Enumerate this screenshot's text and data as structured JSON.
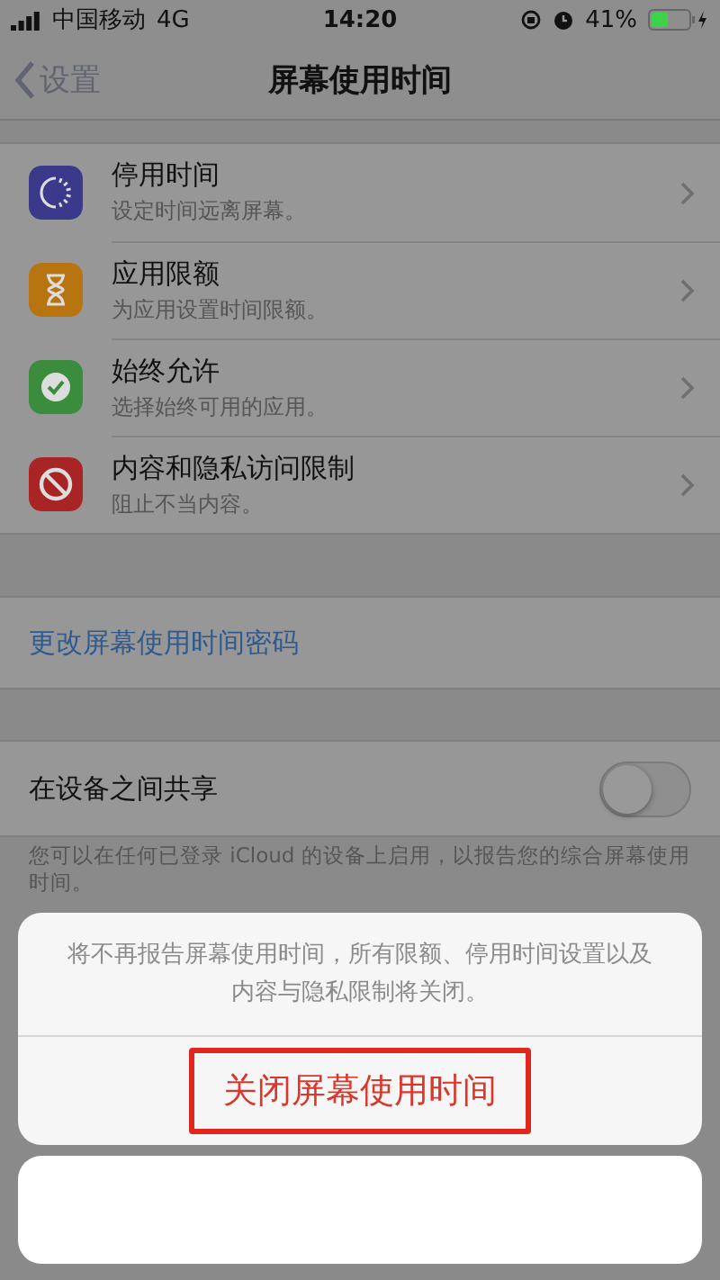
{
  "status_bar": {
    "carrier": "中国移动",
    "network": "4G",
    "time": "14:20",
    "battery": "41%"
  },
  "nav": {
    "back": "设置",
    "title": "屏幕使用时间"
  },
  "items": [
    {
      "kind": "downtime",
      "title": "停用时间",
      "subtitle": "设定时间远离屏幕。",
      "color": "#3b3a8a"
    },
    {
      "kind": "limits",
      "title": "应用限额",
      "subtitle": "为应用设置时间限额。",
      "color": "#b8750f"
    },
    {
      "kind": "allowed",
      "title": "始终允许",
      "subtitle": "选择始终可用的应用。",
      "color": "#3b8c3c"
    },
    {
      "kind": "restrictions",
      "title": "内容和隐私访问限制",
      "subtitle": "阻止不当内容。",
      "color": "#a92525"
    }
  ],
  "passcode_link": "更改屏幕使用时间密码",
  "share": {
    "label": "在设备之间共享",
    "on": false,
    "footnote": "您可以在任何已登录 iCloud 的设备上启用，以报告您的综合屏幕使用时间。"
  },
  "action_sheet": {
    "message": "将不再报告屏幕使用时间，所有限额、停用时间设置以及内容与隐私限制将关闭。",
    "action": "关闭屏幕使用时间",
    "highlighted": true
  }
}
